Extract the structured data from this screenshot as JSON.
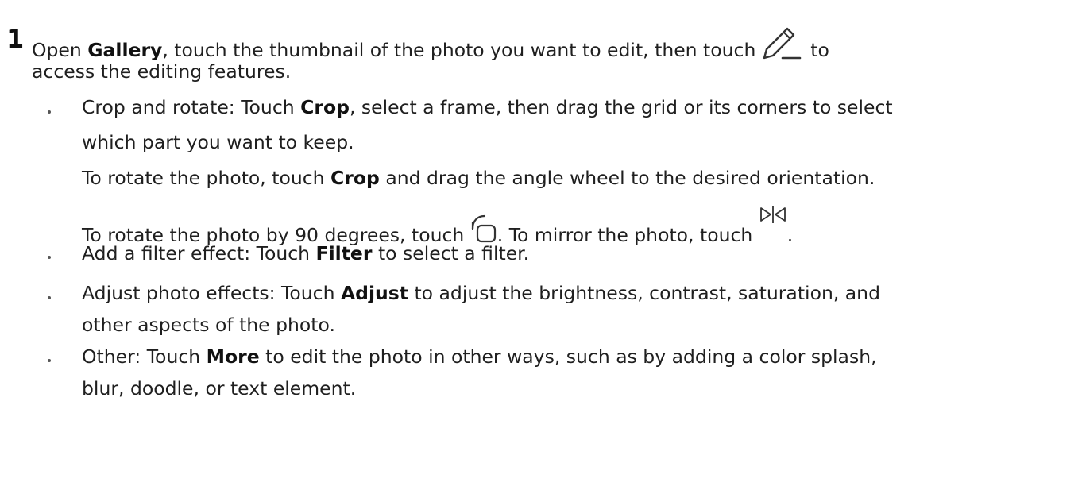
{
  "step": {
    "number": "1",
    "intro": {
      "part1": "Open ",
      "gallery": "Gallery",
      "part2": ", touch the thumbnail of the photo you want to edit, then touch ",
      "part3": " to",
      "line2": "access the editing features."
    },
    "icons": {
      "edit": "pencil-icon",
      "rotate": "rotate-icon",
      "mirror": "mirror-icon"
    }
  },
  "bullets": {
    "crop": {
      "line1_a": "Crop and rotate: Touch ",
      "line1_b": "Crop",
      "line1_c": ", select a frame, then drag the grid or its corners to select",
      "line2": "which part you want to keep.",
      "line3_a": "To rotate the photo, touch ",
      "line3_b": "Crop",
      "line3_c": " and drag the angle wheel to the desired orientation.",
      "line4_a": "To rotate the photo by 90 degrees, touch ",
      "line4_b": ". To mirror the photo, touch ",
      "line4_c": "."
    },
    "filter": {
      "a": "Add a filter effect: Touch ",
      "b": "Filter",
      "c": " to select a filter."
    },
    "adjust": {
      "line1_a": "Adjust photo effects: Touch ",
      "line1_b": "Adjust",
      "line1_c": " to adjust the brightness, contrast, saturation, and",
      "line2": "other aspects of the photo."
    },
    "other": {
      "line1_a": "Other: Touch ",
      "line1_b": "More",
      "line1_c": " to edit the photo in other ways, such as by adding a color splash,",
      "line2": "blur, doodle, or text element."
    }
  }
}
